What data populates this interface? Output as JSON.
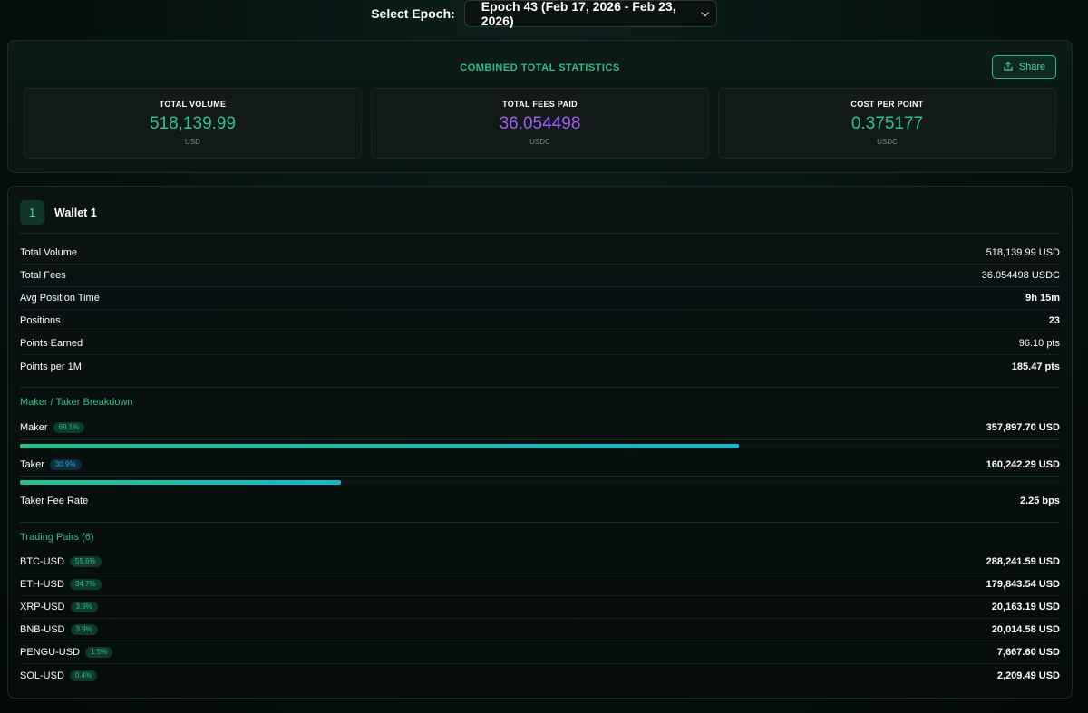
{
  "epoch": {
    "label": "Select Epoch:",
    "selected": "Epoch 43 (Feb 17, 2026 - Feb 23, 2026)"
  },
  "combined": {
    "title": "COMBINED TOTAL STATISTICS",
    "share_label": "Share",
    "cards": [
      {
        "label": "TOTAL VOLUME",
        "value": "518,139.99",
        "unit": "USD",
        "color": "#33c28d"
      },
      {
        "label": "TOTAL FEES PAID",
        "value": "36.054498",
        "unit": "USDC",
        "color": "#a25ef2"
      },
      {
        "label": "COST PER POINT",
        "value": "0.375177",
        "unit": "USDC",
        "color": "#33c28d"
      }
    ]
  },
  "wallet": {
    "number": "1",
    "name": "Wallet 1",
    "stats": [
      {
        "label": "Total Volume",
        "value": "518,139.99 USD"
      },
      {
        "label": "Total Fees",
        "value": "36.054498 USDC"
      },
      {
        "label": "Avg Position Time",
        "value": "9h 15m"
      },
      {
        "label": "Positions",
        "value": "23"
      },
      {
        "label": "Points Earned",
        "value": "96.10 pts"
      },
      {
        "label": "Points per 1M",
        "value": "185.47 pts"
      }
    ],
    "maker_taker": {
      "title": "Maker / Taker Breakdown",
      "maker": {
        "label": "Maker",
        "pct": "69.1%",
        "fraction": 0.691,
        "value": "357,897.70 USD"
      },
      "taker": {
        "label": "Taker",
        "pct": "30.9%",
        "fraction": 0.309,
        "value": "160,242.29 USD"
      },
      "fee_rate": {
        "label": "Taker Fee Rate",
        "value": "2.25 bps"
      }
    },
    "pairs": {
      "title": "Trading Pairs (6)",
      "items": [
        {
          "name": "BTC-USD",
          "pct": "55.6%",
          "value": "288,241.59 USD"
        },
        {
          "name": "ETH-USD",
          "pct": "34.7%",
          "value": "179,843.54 USD"
        },
        {
          "name": "XRP-USD",
          "pct": "3.9%",
          "value": "20,163.19 USD"
        },
        {
          "name": "BNB-USD",
          "pct": "3.9%",
          "value": "20,014.58 USD"
        },
        {
          "name": "PENGU-USD",
          "pct": "1.5%",
          "value": "7,667.60 USD"
        },
        {
          "name": "SOL-USD",
          "pct": "0.4%",
          "value": "2,209.49 USD"
        }
      ]
    }
  },
  "colors": {
    "accent_green": "#2fbf86",
    "accent_purple": "#a25ef2",
    "accent_blue": "#2aa8d6"
  }
}
